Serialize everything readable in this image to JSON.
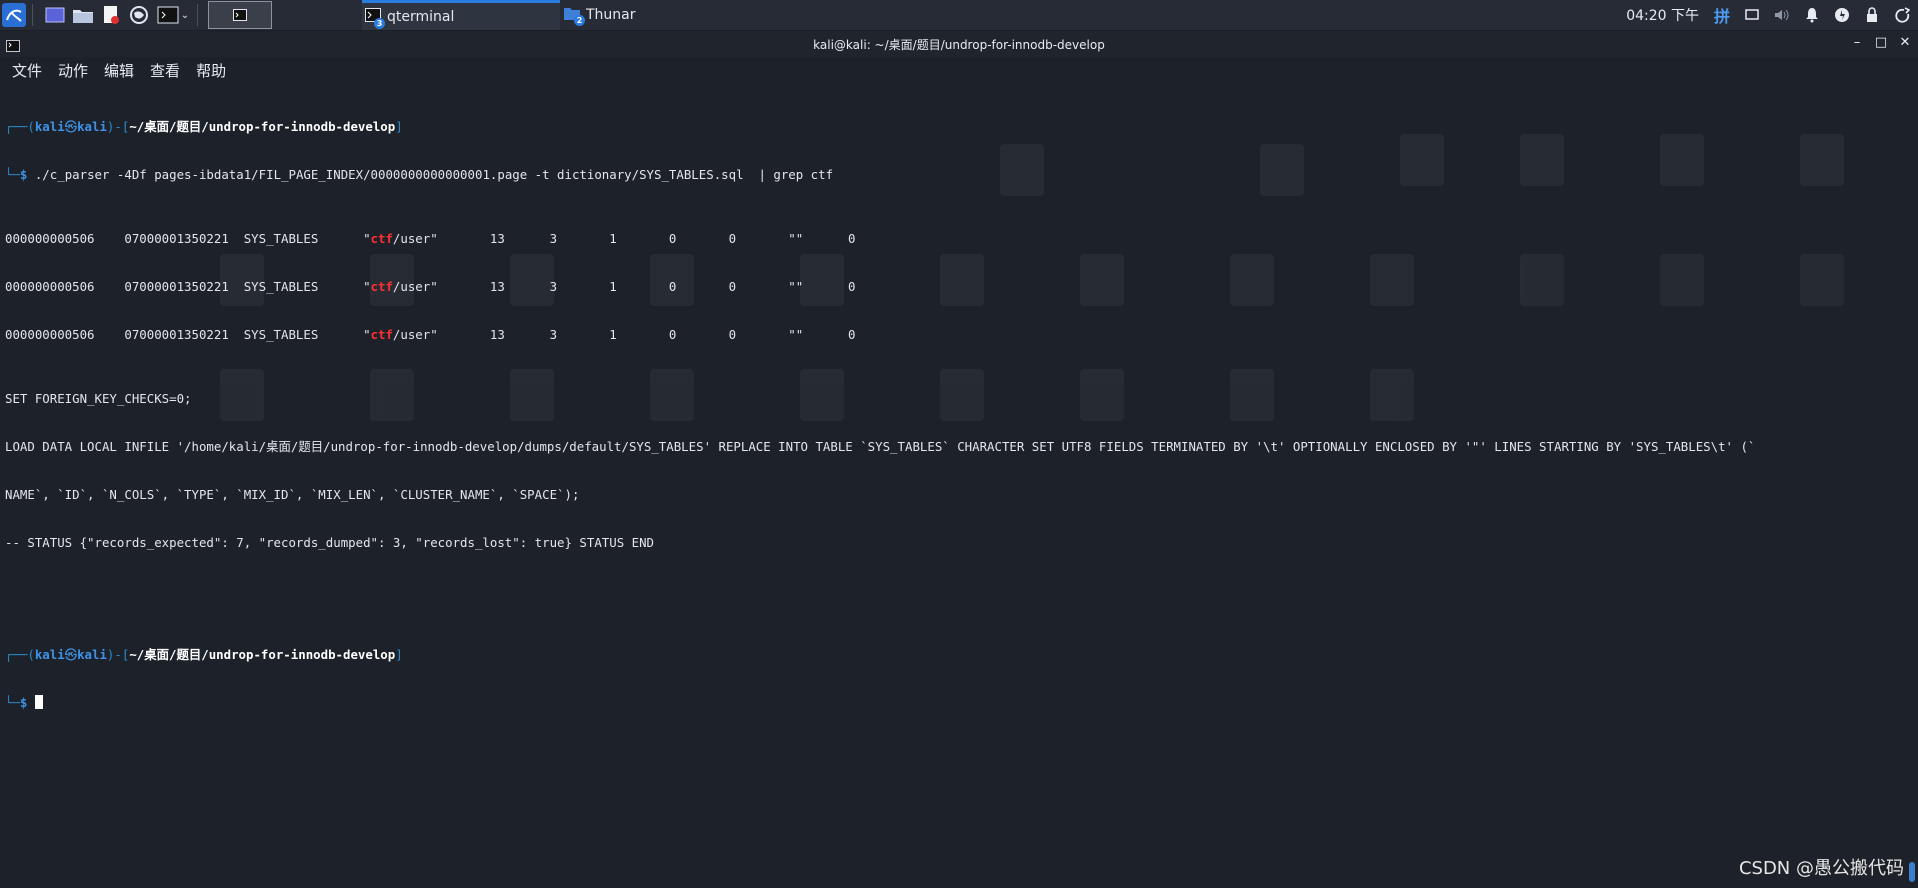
{
  "taskbar": {
    "launchers": [
      {
        "icon": "kali-menu-icon"
      },
      {
        "icon": "desktop-icon"
      },
      {
        "icon": "file-manager-icon"
      },
      {
        "icon": "text-editor-icon"
      },
      {
        "icon": "web-browser-icon"
      },
      {
        "icon": "terminal-icon"
      }
    ],
    "tasks": [
      {
        "label": "qterminal",
        "badge": "3",
        "active": true
      },
      {
        "label": "Thunar",
        "badge": "2",
        "active": false
      }
    ],
    "clock": "04:20 下午",
    "input_method": "拼"
  },
  "window": {
    "title": "kali@kali: ~/桌面/题目/undrop-for-innodb-develop",
    "controls": [
      "minimize",
      "maximize",
      "close"
    ]
  },
  "menu": {
    "items": [
      "文件",
      "动作",
      "编辑",
      "查看",
      "帮助"
    ]
  },
  "terminal": {
    "prompt1": {
      "frame_open": "┌──(",
      "user": "kali",
      "at": "㉿",
      "host": "kali",
      "frame_mid": ")-[",
      "path": "~/桌面/题目/undrop-for-innodb-develop",
      "frame_close": "]",
      "frame_second": "└─",
      "dollar": "$",
      "command": " ./c_parser -4Df pages-ibdata1/FIL_PAGE_INDEX/0000000000000001.page -t dictionary/SYS_TABLES.sql  | grep ctf"
    },
    "rows": [
      {
        "pre": "000000000506    07000001350221  SYS_TABLES      \"",
        "hl": "ctf",
        "post": "/user\"       13      3       1       0       0       \"\"      0"
      },
      {
        "pre": "000000000506    07000001350221  SYS_TABLES      \"",
        "hl": "ctf",
        "post": "/user\"       13      3       1       0       0       \"\"      0"
      },
      {
        "pre": "000000000506    07000001350221  SYS_TABLES      \"",
        "hl": "ctf",
        "post": "/user\"       13      3       1       0       0       \"\"      0"
      }
    ],
    "output": [
      "SET FOREIGN_KEY_CHECKS=0;",
      "LOAD DATA LOCAL INFILE '/home/kali/桌面/题目/undrop-for-innodb-develop/dumps/default/SYS_TABLES' REPLACE INTO TABLE `SYS_TABLES` CHARACTER SET UTF8 FIELDS TERMINATED BY '\\t' OPTIONALLY ENCLOSED BY '\"' LINES STARTING BY 'SYS_TABLES\\t' (`",
      "NAME`, `ID`, `N_COLS`, `TYPE`, `MIX_ID`, `MIX_LEN`, `CLUSTER_NAME`, `SPACE`);",
      "-- STATUS {\"records_expected\": 7, \"records_dumped\": 3, \"records_lost\": true} STATUS END"
    ],
    "prompt2": {
      "frame_open": "┌──(",
      "user": "kali",
      "at": "㉿",
      "host": "kali",
      "frame_mid": ")-[",
      "path": "~/桌面/题目/undrop-for-innodb-develop",
      "frame_close": "]",
      "frame_second": "└─",
      "dollar": "$"
    }
  },
  "watermark": "CSDN @愚公搬代码",
  "colors": {
    "accent": "#2a7ce0",
    "prompt_blue": "#3e92e6",
    "match_red": "#ff3030",
    "background": "#1d2129"
  }
}
